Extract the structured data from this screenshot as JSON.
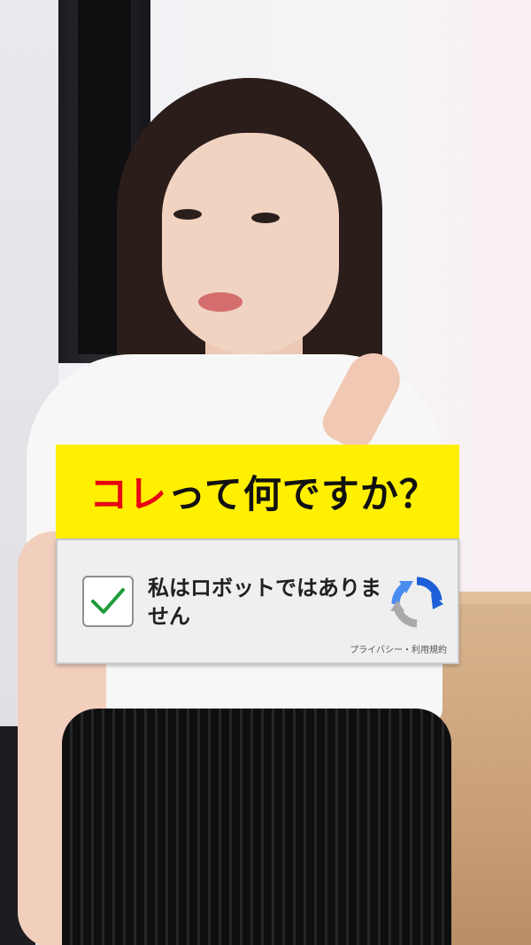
{
  "caption": {
    "accent_text": "コレ",
    "rest_text": "って何ですか？",
    "background_color": "#ffef00",
    "accent_color": "#e60012"
  },
  "captcha": {
    "checkbox_checked": true,
    "label": "私はロボットではありません",
    "footer": "プライバシー・利用規約",
    "logo_icon": "recaptcha-logo-icon",
    "check_icon": "checkmark-icon",
    "check_color": "#1e9c3a"
  }
}
